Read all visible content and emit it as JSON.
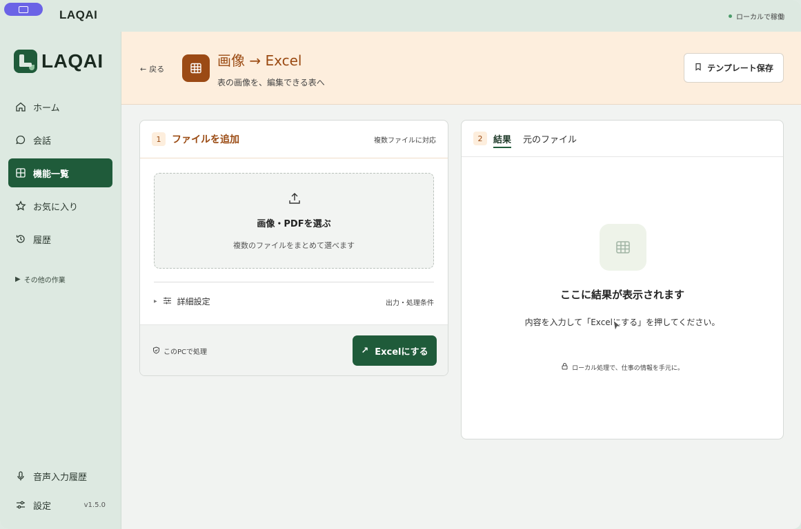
{
  "topbar": {
    "brand": "LAQAI",
    "status": "ローカルで稼働"
  },
  "sidebar": {
    "logo_text": "LAQAI",
    "items": [
      {
        "label": "ホーム",
        "icon": "home-icon"
      },
      {
        "label": "会話",
        "icon": "chat-icon"
      },
      {
        "label": "機能一覧",
        "icon": "grid-icon",
        "active": true
      },
      {
        "label": "お気に入り",
        "icon": "star-icon"
      },
      {
        "label": "履歴",
        "icon": "history-icon"
      }
    ],
    "more_tasks": "その他の作業",
    "bottom": [
      {
        "label": "音声入力履歴",
        "icon": "mic-icon"
      },
      {
        "label": "設定",
        "icon": "settings-icon"
      }
    ],
    "version": "v1.5.0"
  },
  "header": {
    "back": "戻る",
    "title": "画像 → Excel",
    "subtitle": "表の画像を、編集できる表へ",
    "template_button": "テンプレート保存"
  },
  "upload_panel": {
    "step": "1",
    "title": "ファイルを追加",
    "note": "複数ファイルに対応",
    "drop_title": "画像・PDFを選ぶ",
    "drop_sub": "複数のファイルをまとめて選べます",
    "detail_label": "詳細設定",
    "detail_note": "出力・処理条件",
    "local_note": "このPCで処理",
    "run_button": "Excelにする"
  },
  "result_panel": {
    "step": "2",
    "tabs": [
      "結果",
      "元のファイル"
    ],
    "empty_title": "ここに結果が表示されます",
    "empty_sub": "内容を入力して「Excelにする」を押してください。",
    "privacy_note": "ローカル処理で、仕事の情報を手元に。"
  },
  "colors": {
    "accent": "#1f5b3a",
    "header_bg": "#fdeedd",
    "title_orange": "#9a4a12"
  }
}
